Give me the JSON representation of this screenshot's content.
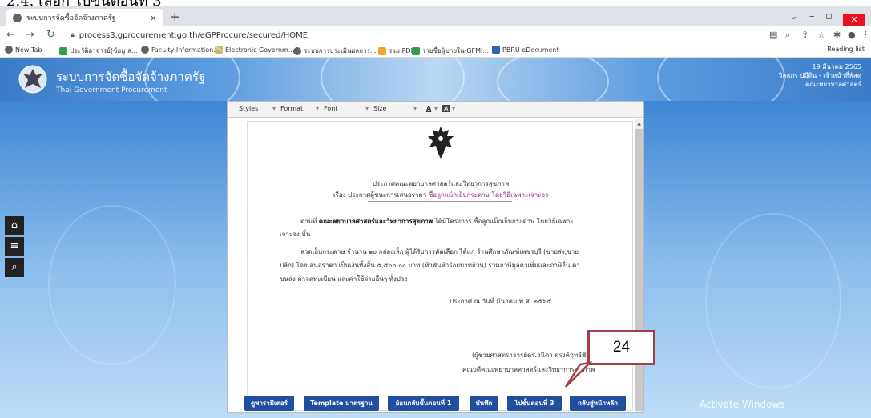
{
  "caption": "2.4. เลือก ไปขั้นตอนที่ 3",
  "browser": {
    "tab_title": "ระบบการจัดซื้อจัดจ้างภาครัฐ",
    "tab_close": "×",
    "new_tab": "+",
    "url": "process3.gprocurement.go.th/eGPProcure/secured/HOME",
    "bookmarks": [
      "New Tab",
      "ประวัติอาจารย์(ข้อมู ล...",
      "Faculty Information...",
      "Electronic Governm...",
      "ระบบการประเมินผลการ...",
      "รวม PDF",
      "รายชื่อผู้ขายใน-GFMI...",
      "PBRU eDocument"
    ],
    "reading_list": "Reading list"
  },
  "site": {
    "title": "ระบบการจัดซื้อจัดจ้างภาครัฐ",
    "subtitle": "Thai Government Procurement",
    "date": "19 มีนาคม 2565",
    "user": "วิลลภร ปมีติน - เจ้าหน้าที่พัสดุ",
    "dept": "คณะพยาบาลศาสตร์"
  },
  "editor": {
    "toolbar": [
      "Styles",
      "Format",
      "Font",
      "Size"
    ],
    "doc": {
      "heading": "ประกาศคณะพยาบาลศาสตร์และวิทยาการสุขภาพ",
      "subject_prefix": "เรื่อง ประกาศผู้ชนะการเสนอราคา",
      "subject_item": "ซื้อลูกแม็กเย็บกระดาษ โดยวิธีเฉพาะเจาะจง",
      "para1_a": "ตามที่",
      "para1_org": "คณะพยาบาลศาสตร์และวิทยาการสุขภาพ",
      "para1_b": "ได้มีโครงการ ซื้อลูกแม็กเย็บกระดาษ โดยวิธีเฉพาะ",
      "para1_c": "เจาะจง นั้น",
      "para2_a": "ลวดเย็บกระดาษ จำนวน ๑๐ กล่องเล็ก ผู้ได้รับการคัดเลือก ได้แก่ ร้านศึกษาภัณฑ์เพชรบุรี (ขายส่ง,ขาย",
      "para2_b": "ปลีก) โดยเสนอราคา เป็นเงินทั้งสิ้น ๕,๕๐๐.๐๐ บาท (ห้าพันห้าร้อยบาทถ้วน) รวมภาษีมูลค่าเพิ่มและภาษีอื่น ค่า",
      "para2_c": "ขนส่ง ค่าจดทะเบียน และค่าใช้จ่ายอื่นๆ ทั้งปวง",
      "announce_date": "ประกาศ ณ วันที่          มีนาคม พ.ศ. ๒๕๖๕",
      "signer": "(ผู้ช่วยศาสตราจารย์ดร.วนิดา ดุรงค์ฤทธิชัย)",
      "signer_title": "คณบดีคณะพยาบาลศาสตร์และวิทยาการสุขภาพ"
    }
  },
  "callout": "24",
  "buttons": [
    "ดูพารามิเตอร์",
    "Template มาตรฐาน",
    "ย้อนกลับขั้นตอนที่ 1",
    "บันทึก",
    "ไปขั้นตอนที่ 3",
    "กลับสู่หน้าหลัก"
  ],
  "activate_windows": "Activate Windows",
  "colors": {
    "header": "#3b7cc8",
    "button": "#1f4f9e",
    "callout_border": "#a04048",
    "close": "#e81123"
  }
}
